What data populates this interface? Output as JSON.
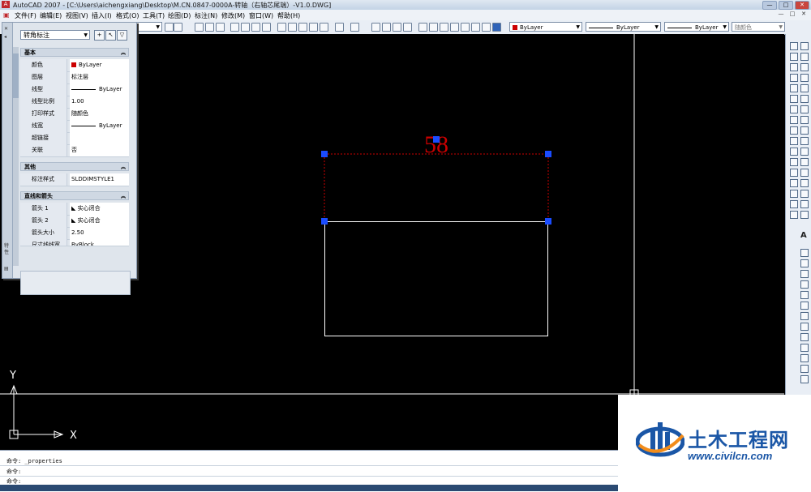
{
  "window": {
    "title": "AutoCAD 2007 - [C:\\Users\\aichengxiang\\Desktop\\M.CN.0847-0000A-转轴（右轴芯尾端）-V1.0.DWG]",
    "min": "—",
    "max": "□",
    "close": "✕"
  },
  "menu": {
    "items": [
      "文件(F)",
      "编辑(E)",
      "视图(V)",
      "插入(I)",
      "格式(O)",
      "工具(T)",
      "绘图(D)",
      "标注(N)",
      "修改(M)",
      "窗口(W)",
      "帮助(H)"
    ]
  },
  "toolbar": {
    "layer_combo": "ByLayer",
    "linetype_combo": "ByLayer",
    "lineweight_combo": "ByLayer",
    "plotstyle_combo": "随颜色"
  },
  "properties": {
    "selection": "转角标注",
    "sections": {
      "basic": "基本",
      "other": "其他",
      "lines_arrows": "直线和箭头"
    },
    "basic_rows": [
      {
        "key": "颜色",
        "value": "ByLayer"
      },
      {
        "key": "图层",
        "value": "标注层"
      },
      {
        "key": "线型",
        "value": "ByLayer"
      },
      {
        "key": "线型比例",
        "value": "1.00"
      },
      {
        "key": "打印样式",
        "value": "随颜色"
      },
      {
        "key": "线宽",
        "value": "ByLayer"
      },
      {
        "key": "超链接",
        "value": ""
      },
      {
        "key": "关联",
        "value": "否"
      }
    ],
    "other_rows": [
      {
        "key": "标注样式",
        "value": "SLDDIMSTYLE1"
      }
    ],
    "arrow_rows": [
      {
        "key": "箭头 1",
        "value": "实心闭合"
      },
      {
        "key": "箭头 2",
        "value": "实心闭合"
      },
      {
        "key": "箭头大小",
        "value": "2.50"
      },
      {
        "key": "尺寸线线宽",
        "value": "ByBlock"
      }
    ],
    "strip_label": "特性",
    "colors": {
      "color_swatch": "#cc0000"
    }
  },
  "drawing": {
    "dimension_text": "58",
    "ucs_y": "Y",
    "ucs_x": "X",
    "colors": {
      "dimension": "#cc0000",
      "grip": "#1a4cff",
      "geometry": "#ffffff"
    }
  },
  "command": {
    "line1": "命令: _properties",
    "line2": "命令:",
    "line3": "命令:"
  },
  "watermark": {
    "name": "土木工程网",
    "url": "www.civilcn.com",
    "colors": {
      "brand": "#1a56a6",
      "accent": "#f28c1a"
    }
  }
}
